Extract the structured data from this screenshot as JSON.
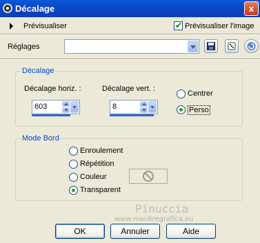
{
  "window": {
    "title": "Décalage",
    "close_label": "x"
  },
  "preview": {
    "label": "Prévisualiser",
    "checkbox_label": "Prévisualiser l'image",
    "checked": true
  },
  "settings": {
    "label": "Réglages",
    "value": ""
  },
  "offset_group": {
    "title": "Décalage",
    "horiz_label": "Décalage horiz. :",
    "horiz_value": "603",
    "vert_label": "Décalage vert. :",
    "vert_value": "8",
    "options": [
      {
        "label": "Centrer",
        "selected": false
      },
      {
        "label": "Perso",
        "selected": true
      }
    ]
  },
  "edge_group": {
    "title": "Mode Bord",
    "options": [
      {
        "label": "Enroulement",
        "selected": false
      },
      {
        "label": "Répétition",
        "selected": false
      },
      {
        "label": "Couleur",
        "selected": false
      },
      {
        "label": "Transparent",
        "selected": true
      }
    ]
  },
  "watermark": {
    "name": "Pinuccia",
    "url": "www.maidiregrafica.eu"
  },
  "buttons": {
    "ok": "OK",
    "cancel": "Annuler",
    "help": "Aide"
  },
  "colors": {
    "titlebar": "#0a5ad8",
    "group_title": "#0046d5",
    "check": "#21a121"
  }
}
